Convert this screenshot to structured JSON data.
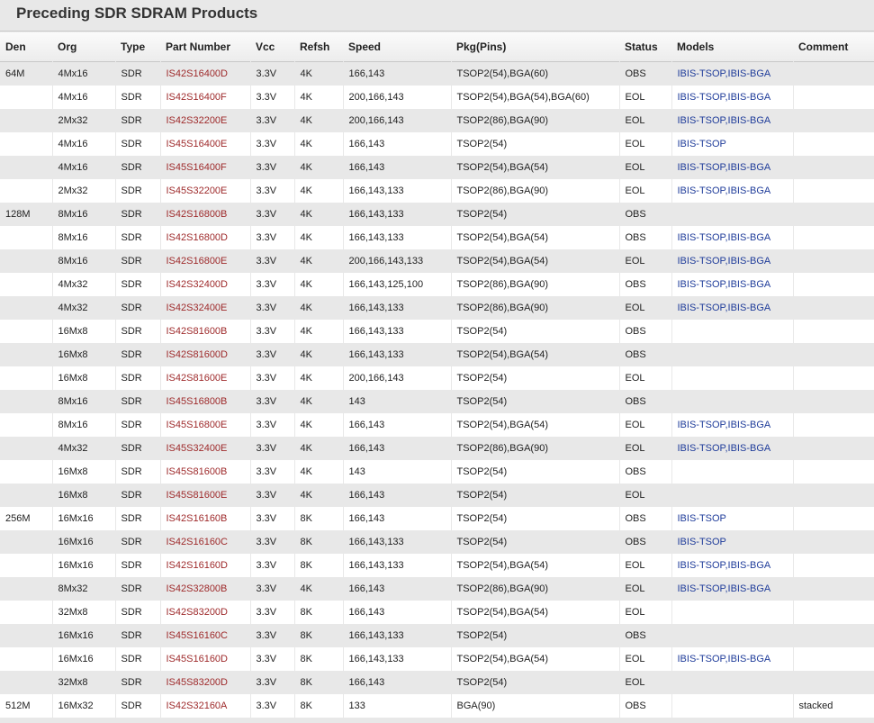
{
  "page": {
    "title": "Preceding SDR SDRAM Products"
  },
  "table": {
    "headers": [
      "Den",
      "Org",
      "Type",
      "Part Number",
      "Vcc",
      "Refsh",
      "Speed",
      "Pkg(Pins)",
      "Status",
      "Models",
      "Comment"
    ],
    "rows": [
      [
        "64M",
        "4Mx16",
        "SDR",
        "IS42S16400D",
        "3.3V",
        "4K",
        "166,143",
        "TSOP2(54),BGA(60)",
        "OBS",
        "IBIS-TSOP,IBIS-BGA",
        ""
      ],
      [
        "",
        "4Mx16",
        "SDR",
        "IS42S16400F",
        "3.3V",
        "4K",
        "200,166,143",
        "TSOP2(54),BGA(54),BGA(60)",
        "EOL",
        "IBIS-TSOP,IBIS-BGA",
        ""
      ],
      [
        "",
        "2Mx32",
        "SDR",
        "IS42S32200E",
        "3.3V",
        "4K",
        "200,166,143",
        "TSOP2(86),BGA(90)",
        "EOL",
        "IBIS-TSOP,IBIS-BGA",
        ""
      ],
      [
        "",
        "4Mx16",
        "SDR",
        "IS45S16400E",
        "3.3V",
        "4K",
        "166,143",
        "TSOP2(54)",
        "EOL",
        "IBIS-TSOP",
        ""
      ],
      [
        "",
        "4Mx16",
        "SDR",
        "IS45S16400F",
        "3.3V",
        "4K",
        "166,143",
        "TSOP2(54),BGA(54)",
        "EOL",
        "IBIS-TSOP,IBIS-BGA",
        ""
      ],
      [
        "",
        "2Mx32",
        "SDR",
        "IS45S32200E",
        "3.3V",
        "4K",
        "166,143,133",
        "TSOP2(86),BGA(90)",
        "EOL",
        "IBIS-TSOP,IBIS-BGA",
        ""
      ],
      [
        "128M",
        "8Mx16",
        "SDR",
        "IS42S16800B",
        "3.3V",
        "4K",
        "166,143,133",
        "TSOP2(54)",
        "OBS",
        "",
        ""
      ],
      [
        "",
        "8Mx16",
        "SDR",
        "IS42S16800D",
        "3.3V",
        "4K",
        "166,143,133",
        "TSOP2(54),BGA(54)",
        "OBS",
        "IBIS-TSOP,IBIS-BGA",
        ""
      ],
      [
        "",
        "8Mx16",
        "SDR",
        "IS42S16800E",
        "3.3V",
        "4K",
        "200,166,143,133",
        "TSOP2(54),BGA(54)",
        "EOL",
        "IBIS-TSOP,IBIS-BGA",
        ""
      ],
      [
        "",
        "4Mx32",
        "SDR",
        "IS42S32400D",
        "3.3V",
        "4K",
        "166,143,125,100",
        "TSOP2(86),BGA(90)",
        "OBS",
        "IBIS-TSOP,IBIS-BGA",
        ""
      ],
      [
        "",
        "4Mx32",
        "SDR",
        "IS42S32400E",
        "3.3V",
        "4K",
        "166,143,133",
        "TSOP2(86),BGA(90)",
        "EOL",
        "IBIS-TSOP,IBIS-BGA",
        ""
      ],
      [
        "",
        "16Mx8",
        "SDR",
        "IS42S81600B",
        "3.3V",
        "4K",
        "166,143,133",
        "TSOP2(54)",
        "OBS",
        "",
        ""
      ],
      [
        "",
        "16Mx8",
        "SDR",
        "IS42S81600D",
        "3.3V",
        "4K",
        "166,143,133",
        "TSOP2(54),BGA(54)",
        "OBS",
        "",
        ""
      ],
      [
        "",
        "16Mx8",
        "SDR",
        "IS42S81600E",
        "3.3V",
        "4K",
        "200,166,143",
        "TSOP2(54)",
        "EOL",
        "",
        ""
      ],
      [
        "",
        "8Mx16",
        "SDR",
        "IS45S16800B",
        "3.3V",
        "4K",
        "143",
        "TSOP2(54)",
        "OBS",
        "",
        ""
      ],
      [
        "",
        "8Mx16",
        "SDR",
        "IS45S16800E",
        "3.3V",
        "4K",
        "166,143",
        "TSOP2(54),BGA(54)",
        "EOL",
        "IBIS-TSOP,IBIS-BGA",
        ""
      ],
      [
        "",
        "4Mx32",
        "SDR",
        "IS45S32400E",
        "3.3V",
        "4K",
        "166,143",
        "TSOP2(86),BGA(90)",
        "EOL",
        "IBIS-TSOP,IBIS-BGA",
        ""
      ],
      [
        "",
        "16Mx8",
        "SDR",
        "IS45S81600B",
        "3.3V",
        "4K",
        "143",
        "TSOP2(54)",
        "OBS",
        "",
        ""
      ],
      [
        "",
        "16Mx8",
        "SDR",
        "IS45S81600E",
        "3.3V",
        "4K",
        "166,143",
        "TSOP2(54)",
        "EOL",
        "",
        ""
      ],
      [
        "256M",
        "16Mx16",
        "SDR",
        "IS42S16160B",
        "3.3V",
        "8K",
        "166,143",
        "TSOP2(54)",
        "OBS",
        "IBIS-TSOP",
        ""
      ],
      [
        "",
        "16Mx16",
        "SDR",
        "IS42S16160C",
        "3.3V",
        "8K",
        "166,143,133",
        "TSOP2(54)",
        "OBS",
        "IBIS-TSOP",
        ""
      ],
      [
        "",
        "16Mx16",
        "SDR",
        "IS42S16160D",
        "3.3V",
        "8K",
        "166,143,133",
        "TSOP2(54),BGA(54)",
        "EOL",
        "IBIS-TSOP,IBIS-BGA",
        ""
      ],
      [
        "",
        "8Mx32",
        "SDR",
        "IS42S32800B",
        "3.3V",
        "4K",
        "166,143",
        "TSOP2(86),BGA(90)",
        "EOL",
        "IBIS-TSOP,IBIS-BGA",
        ""
      ],
      [
        "",
        "32Mx8",
        "SDR",
        "IS42S83200D",
        "3.3V",
        "8K",
        "166,143",
        "TSOP2(54),BGA(54)",
        "EOL",
        "",
        ""
      ],
      [
        "",
        "16Mx16",
        "SDR",
        "IS45S16160C",
        "3.3V",
        "8K",
        "166,143,133",
        "TSOP2(54)",
        "OBS",
        "",
        ""
      ],
      [
        "",
        "16Mx16",
        "SDR",
        "IS45S16160D",
        "3.3V",
        "8K",
        "166,143,133",
        "TSOP2(54),BGA(54)",
        "EOL",
        "IBIS-TSOP,IBIS-BGA",
        ""
      ],
      [
        "",
        "32Mx8",
        "SDR",
        "IS45S83200D",
        "3.3V",
        "8K",
        "166,143",
        "TSOP2(54)",
        "EOL",
        "",
        ""
      ],
      [
        "512M",
        "16Mx32",
        "SDR",
        "IS42S32160A",
        "3.3V",
        "8K",
        "133",
        "BGA(90)",
        "OBS",
        "",
        "stacked"
      ]
    ]
  }
}
